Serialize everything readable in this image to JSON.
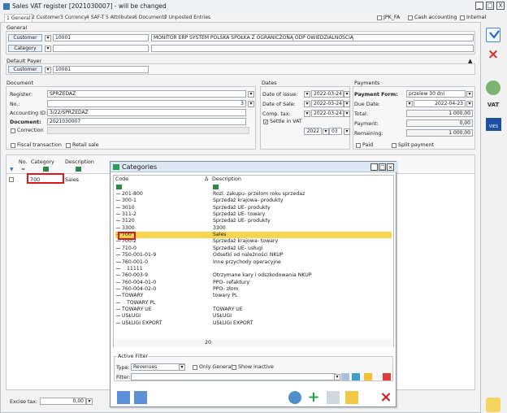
{
  "window": {
    "title": "Sales VAT register [2021030007] - will be changed",
    "controls": [
      "_",
      "□",
      "X"
    ]
  },
  "tabs": [
    "1 General",
    "2 Customer",
    "3 Currency",
    "4 SAF-T",
    "5 Attributes",
    "6 Documents",
    "7 Unposted Entries"
  ],
  "flags": {
    "jpk_fa": "JPK_FA",
    "cash_accounting": "Cash accounting",
    "internal": "Internal"
  },
  "general": {
    "section": "General",
    "customer_btn": "Customer",
    "customer_code": "10001",
    "customer_name": "MONITOR ERP SYSTEM POLSKA SPÓŁKA Z OGRANICZONĄ ODP OWIEDZIALNOŚCIĄ",
    "category_btn": "Category"
  },
  "default_payer": {
    "section": "Default Payer",
    "customer_btn": "Customer",
    "customer_code": "10001"
  },
  "document": {
    "section": "Document",
    "register_label": "Register:",
    "register_value": "SPRZEDAŻ",
    "no_label": "No.:",
    "no_value": "3",
    "accounting_label": "Accounting ID:",
    "accounting_value": "3/22/SPRZEDAŻ",
    "document_label": "Document:",
    "document_value": "2021030007",
    "correction": "Correction",
    "fiscal": "Fiscal transaction",
    "retail": "Retail sale"
  },
  "dates": {
    "section": "Dates",
    "issue_label": "Date of issue:",
    "issue_value": "2022-03-24",
    "sale_label": "Date of Sale:",
    "sale_value": "2022-03-24",
    "comp_tax_label": "Comp. tax:",
    "comp_tax_value": "2022-03-24",
    "settle_vat": "Settle in VAT",
    "year": "2022",
    "month": "03"
  },
  "payments": {
    "section": "Payments",
    "form_label": "Payment Form:",
    "form_value": "przelew 30 dni",
    "due_label": "Due Date:",
    "due_value": "2022-04-23",
    "total_label": "Total:",
    "total_value": "1 000,00",
    "payment_label": "Payment:",
    "payment_value": "0,00",
    "remaining_label": "Remaining:",
    "remaining_value": "1 000,00",
    "paid": "Paid",
    "split": "Split payment"
  },
  "grid": {
    "headers": [
      "No.",
      "Category",
      "Description"
    ],
    "row": {
      "category": "700",
      "description": "Sales"
    }
  },
  "excise": {
    "label": "Excise tax:",
    "value": "0,00"
  },
  "side_labels": {
    "vat": "VAT",
    "vies": "VIES"
  },
  "categories_dialog": {
    "title": "Categories",
    "col_code": "Code",
    "col_desc": "Description",
    "sort_marker": "Δ",
    "rows": [
      {
        "code": "201-800",
        "desc": "Rozl. zakupu- przelom roku sprzedaz",
        "indent": 1
      },
      {
        "code": "300-1",
        "desc": "Sprzedaż krajowa- produkty",
        "indent": 1
      },
      {
        "code": "3010",
        "desc": "Sprzedaż UE- produkty",
        "indent": 1
      },
      {
        "code": "311-2",
        "desc": "Sprzedaż UE- towary",
        "indent": 1
      },
      {
        "code": "3120",
        "desc": "Sprzedaż UE- produkty",
        "indent": 1
      },
      {
        "code": "3300",
        "desc": "3300",
        "indent": 1
      },
      {
        "code": "700",
        "desc": "Sales",
        "indent": 1
      },
      {
        "code": "700-2",
        "desc": "Sprzedaż krajowa- towary",
        "indent": 1
      },
      {
        "code": "710-0",
        "desc": "Sprzedaż UE- usługi",
        "indent": 1
      },
      {
        "code": "750-001-01-9",
        "desc": "Odsetki od należności NKUP",
        "indent": 1
      },
      {
        "code": "760-001-0",
        "desc": "Inne przychody operacyjne",
        "indent": 0
      },
      {
        "code": "11111",
        "desc": "",
        "indent": 2
      },
      {
        "code": "760-003-9",
        "desc": "Otrzymane kary i odszkodowania NKUP",
        "indent": 1
      },
      {
        "code": "760-004-01-0",
        "desc": "PPO- refaktury",
        "indent": 1
      },
      {
        "code": "760-004-02-0",
        "desc": "PPO- złom",
        "indent": 1
      },
      {
        "code": "TOWARY",
        "desc": "towary PL",
        "indent": 0
      },
      {
        "code": "TOWARY PL",
        "desc": "",
        "indent": 2
      },
      {
        "code": "TOWARY UE",
        "desc": "TOWARY UE",
        "indent": 1
      },
      {
        "code": "USŁUGI",
        "desc": "USŁUGI",
        "indent": 1
      },
      {
        "code": "USŁUGI EXPORT",
        "desc": "USŁUGI EXPORT",
        "indent": 1
      }
    ],
    "count": "20",
    "active_filter": "Active Filter",
    "type_label": "Type:",
    "type_value": "Revenues",
    "only_general": "Only General",
    "show_inactive": "Show inactive",
    "filter_label": "Filter:"
  }
}
